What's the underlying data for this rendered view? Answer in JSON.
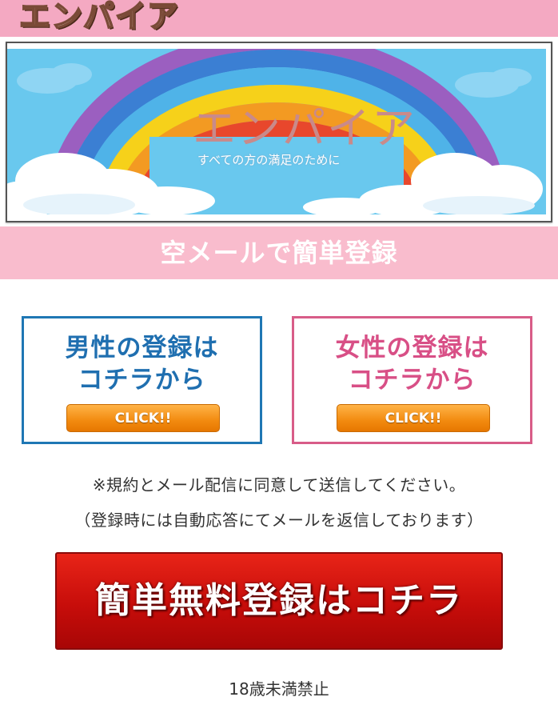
{
  "header": {
    "logo_text": "エンパイア",
    "bar_color": "#f4a9c2"
  },
  "banner": {
    "title": "エンパイア",
    "subtitle": "すべての方の満足のために"
  },
  "registration_bar": {
    "label": "空メールで簡単登録",
    "color": "#f9bccd"
  },
  "male": {
    "line1": "男性の登録は",
    "line2": "コチラから",
    "button": "CLICK!!",
    "color": "#1f77b4"
  },
  "female": {
    "line1": "女性の登録は",
    "line2": "コチラから",
    "button": "CLICK!!",
    "color": "#d85c88"
  },
  "notes": {
    "agree": "※規約とメール配信に同意して送信してください。",
    "auto_reply": "（登録時には自動応答にてメールを返信しております）"
  },
  "free_register_button": {
    "label": "簡単無料登録はコチラ",
    "color": "#c70d0a"
  },
  "age_notice": "18歳未満禁止"
}
